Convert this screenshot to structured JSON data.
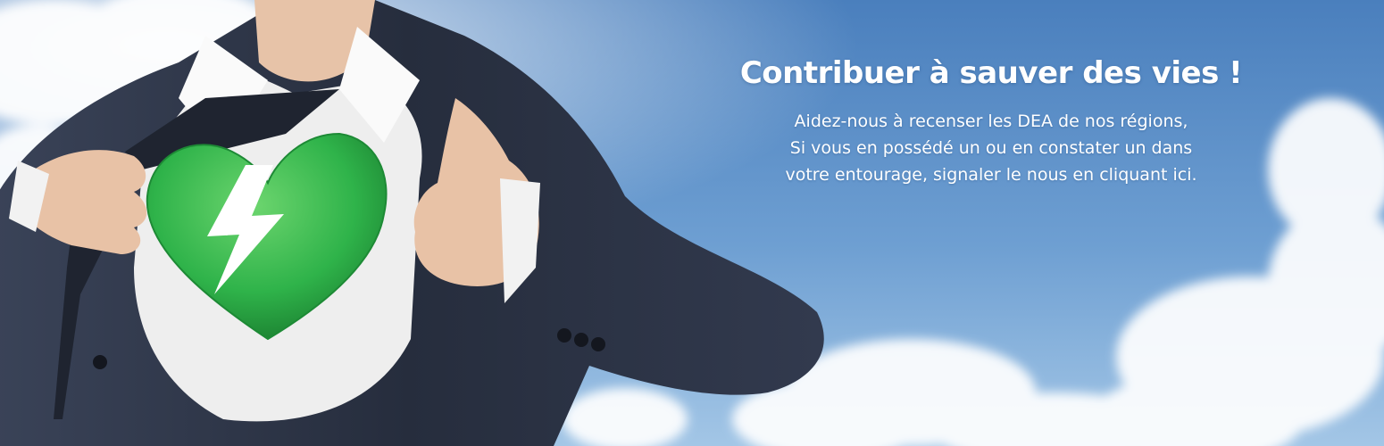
{
  "banner": {
    "headline": "Contribuer à sauver des vies !",
    "lines": [
      "Aidez-nous à recenser les DEA de nos régions,",
      "Si vous en possédé un ou en constater un dans",
      "votre entourage, signaler le nous en "
    ],
    "link_text": "cliquant ici",
    "trailing": "."
  },
  "colors": {
    "sky_top": "#4a7fbd",
    "sky_bottom": "#8cb9e2",
    "suit": "#2c3446",
    "heart_green": "#2fb34a",
    "bolt": "#ffffff",
    "text": "#ffffff"
  },
  "icons": {
    "heart_emblem": "green-heart-lightning-icon"
  }
}
